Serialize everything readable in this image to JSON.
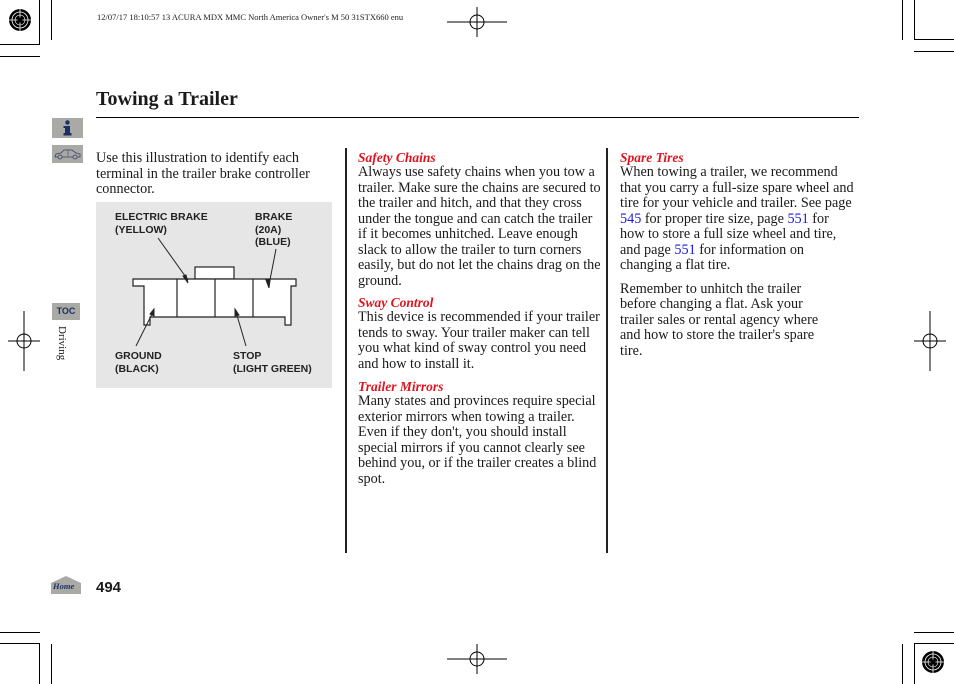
{
  "header": {
    "meta": "12/07/17 18:10:57   13 ACURA MDX MMC North America Owner's M 50 31STX660 enu"
  },
  "page": {
    "title": "Towing a Trailer",
    "section_label": "Driving",
    "page_number": "494"
  },
  "sidebar": {
    "info_icon": "info-icon",
    "car_icon": "car-icon",
    "toc_label": "TOC",
    "home_label": "Home"
  },
  "intro": {
    "text": "Use this illustration to identify each terminal in the trailer brake controller connector."
  },
  "diagram": {
    "labels": {
      "electric_brake": [
        "ELECTRIC BRAKE",
        "(YELLOW)"
      ],
      "brake": [
        "BRAKE",
        "(20A)",
        "(BLUE)"
      ],
      "ground": [
        "GROUND",
        "(BLACK)"
      ],
      "stop": [
        "STOP",
        "(LIGHT GREEN)"
      ]
    },
    "electric_brake_1": "ELECTRIC BRAKE",
    "electric_brake_2": "(YELLOW)",
    "brake_1": "BRAKE",
    "brake_2": "(20A)",
    "brake_3": "(BLUE)",
    "ground_1": "GROUND",
    "ground_2": "(BLACK)",
    "stop_1": "STOP",
    "stop_2": "(LIGHT GREEN)"
  },
  "middle": {
    "safety_chains": {
      "heading": "Safety Chains",
      "body": "Always use safety chains when you tow a trailer. Make sure the chains are secured to the trailer and hitch, and that they cross under the tongue and can catch the trailer if it becomes unhitched. Leave enough slack to allow the trailer to turn corners easily, but do not let the chains drag on the ground."
    },
    "sway_control": {
      "heading": "Sway Control",
      "body": "This device is recommended if your trailer tends to sway. Your trailer maker can tell you what kind of sway control you need and how to install it."
    },
    "trailer_mirrors": {
      "heading": "Trailer Mirrors",
      "body": "Many states and provinces require special exterior mirrors when towing a trailer. Even if they don't, you should install special mirrors if you cannot clearly see behind you, or if the trailer creates a blind spot."
    }
  },
  "right": {
    "spare_tires": {
      "heading": "Spare Tires",
      "body_1": "When towing a trailer, we recommend that you carry a full-size spare wheel and tire for your vehicle and trailer. See page ",
      "link_1": "545",
      "body_2": " for proper tire size, page ",
      "link_2": "551",
      "body_3": " for how to store a full size wheel and tire, and page ",
      "link_3": "551",
      "body_4": " for information on changing a flat tire."
    },
    "remember": "Remember to unhitch the trailer before changing a flat. Ask your trailer sales or rental agency where and how to store the trailer's spare tire."
  },
  "colors": {
    "heading_red": "#e0141e",
    "link_blue": "#1a1adc",
    "nav_gray": "#a9aaa5",
    "icon_navy": "#1c2f66"
  }
}
